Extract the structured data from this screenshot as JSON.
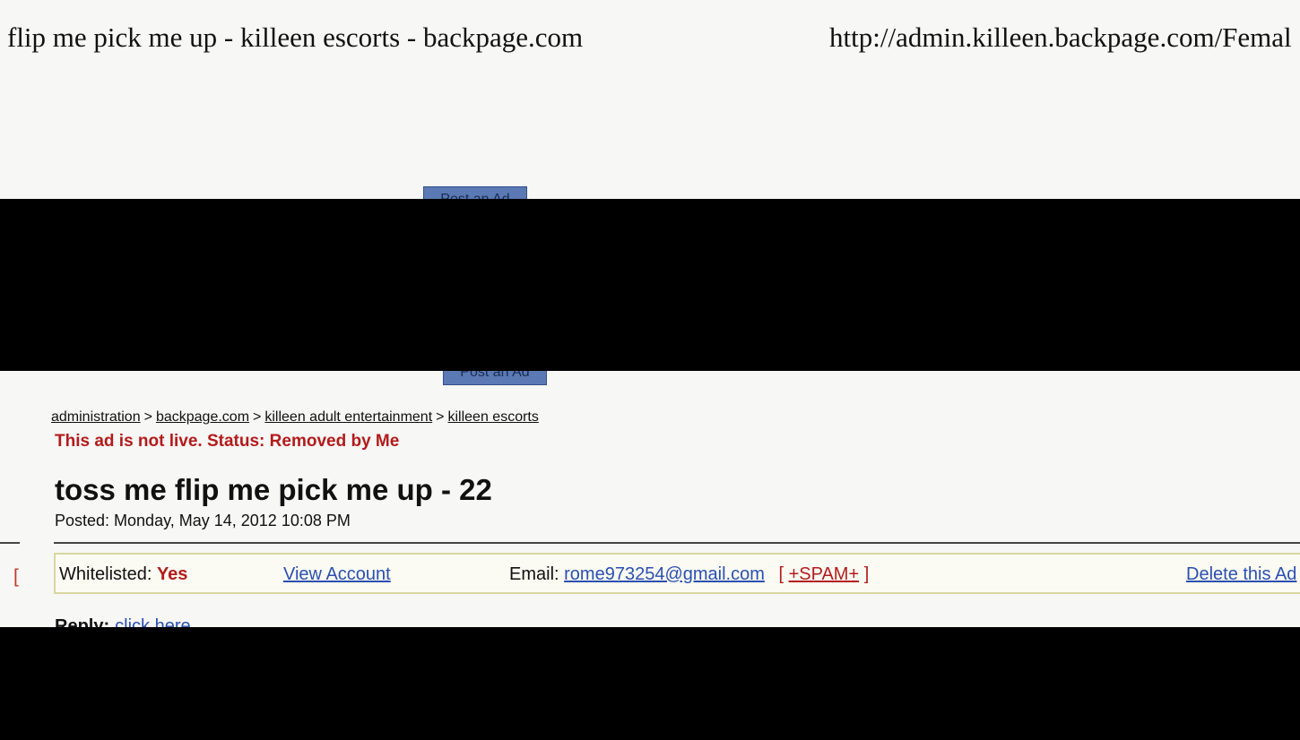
{
  "print_header": {
    "title": "flip me pick me up - killeen escorts - backpage.com",
    "url": "http://admin.killeen.backpage.com/Femal"
  },
  "buttons": {
    "post_ad_top": "Post an Ad",
    "post_ad_bottom": "Post an Ad"
  },
  "breadcrumb": {
    "items": [
      "administration",
      "backpage.com",
      "killeen adult entertainment",
      "killeen escorts"
    ],
    "separator": ">"
  },
  "status": "This ad is not live. Status: Removed by Me",
  "ad": {
    "title": "toss me flip me pick me up - 22",
    "posted": "Posted: Monday, May 14, 2012 10:08 PM"
  },
  "admin_bar": {
    "left_bracket": "[",
    "whitelisted_label": "Whitelisted:",
    "whitelisted_value": "Yes",
    "view_account": "View Account",
    "email_label": "Email:",
    "email_value": "rome973254@gmail.com",
    "spam_open": "[",
    "spam_link": "+SPAM+",
    "spam_close": "]",
    "delete": "Delete this Ad"
  },
  "reply": {
    "label": "Reply:",
    "link": "click here"
  }
}
